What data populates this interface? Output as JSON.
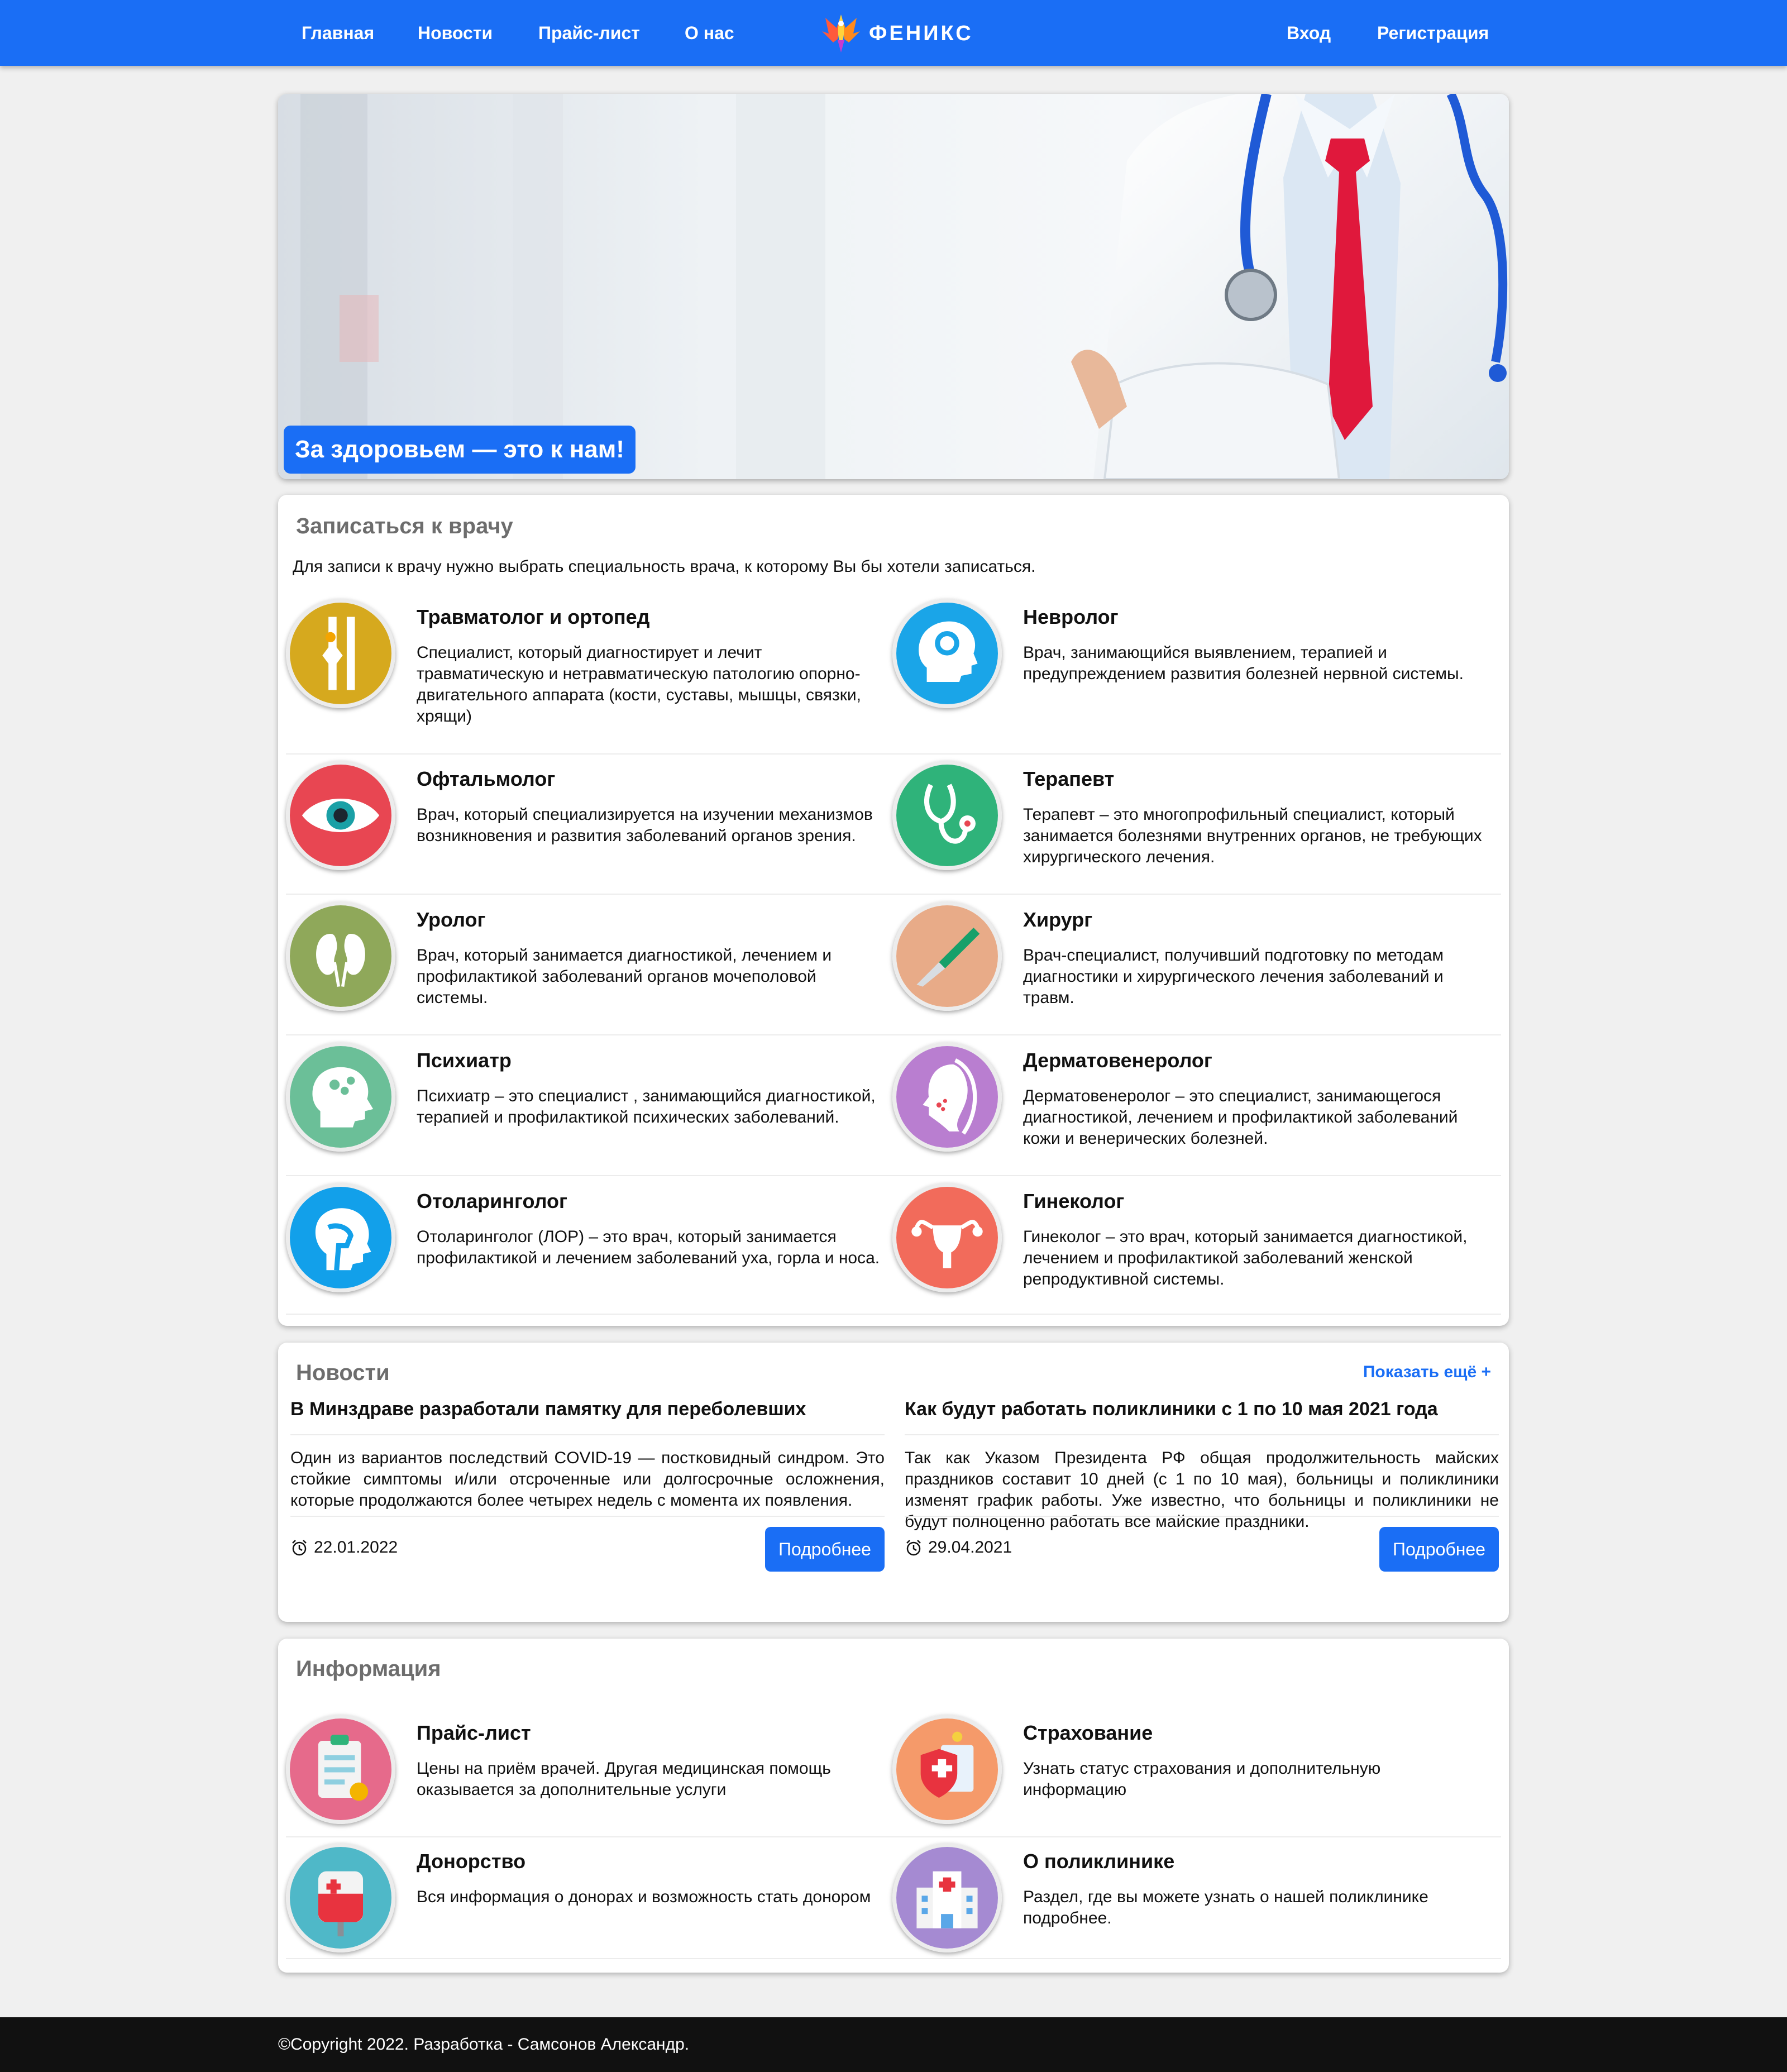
{
  "nav": {
    "links": [
      "Главная",
      "Новости",
      "Прайс-лист",
      "О нас"
    ],
    "brand": "ФЕНИКС",
    "login": "Вход",
    "register": "Регистрация"
  },
  "hero": {
    "slogan": "За здоровьем — это к нам!"
  },
  "doctors": {
    "title": "Записаться к врачу",
    "intro": "Для записи к врачу нужно выбрать специальность врача, к которому Вы бы хотели записаться.",
    "items": [
      {
        "title": "Травматолог и ортопед",
        "desc": "Специалист, который диагностирует и лечит травматическую и нетравматическую патологию опорно-двигательного аппарата (кости, суставы, мышцы, связки, хрящи)",
        "icon": "bone-joint-icon",
        "color": "#d6a91e"
      },
      {
        "title": "Невролог",
        "desc": "Врач, занимающийся выявлением, терапией и предупреждением развития болезней нервной системы.",
        "icon": "brain-head-icon",
        "color": "#1aa5e8"
      },
      {
        "title": "Офтальмолог",
        "desc": "Врач, который специализируется на изучении механизмов возникновения и развития заболеваний органов зрения.",
        "icon": "eye-icon",
        "color": "#e84652"
      },
      {
        "title": "Терапевт",
        "desc": "Терапевт – это многопрофильный специалист, который занимается болезнями внутренних органов, не требующих хирургического лечения.",
        "icon": "stethoscope-icon",
        "color": "#2fb37a"
      },
      {
        "title": "Уролог",
        "desc": "Врач, который занимается диагностикой, лечением и профилактикой заболеваний органов мочеполовой системы.",
        "icon": "kidneys-icon",
        "color": "#8fa85a"
      },
      {
        "title": "Хирург",
        "desc": "Врач-специалист, получивший подготовку по методам диагностики и хирургического лечения заболеваний и травм.",
        "icon": "scalpel-icon",
        "color": "#e8ab88"
      },
      {
        "title": "Психиатр",
        "desc": "Психиатр – это специалист , занимающийся диагностикой, терапией и профилактикой психических заболеваний.",
        "icon": "mind-head-icon",
        "color": "#6bbf98"
      },
      {
        "title": "Дерматовенеролог",
        "desc": "Дерматовенеролог – это специалист, занимающегося диагностикой, лечением и профилактикой заболеваний кожи и венерических болезней.",
        "icon": "face-skin-icon",
        "color": "#b97ed0"
      },
      {
        "title": "Отоларинголог",
        "desc": "Отоларинголог (ЛОР) – это врач, который занимается профилактикой и лечением заболеваний уха, горла и носа.",
        "icon": "ent-head-icon",
        "color": "#12a0ea"
      },
      {
        "title": "Гинеколог",
        "desc": "Гинеколог – это врач, который занимается диагностикой, лечением и профилактикой заболеваний женской репродуктивной системы.",
        "icon": "uterus-icon",
        "color": "#f26b5b"
      }
    ]
  },
  "news": {
    "title": "Новости",
    "show_more": "Показать ещё +",
    "items": [
      {
        "title": "В Минздраве разработали памятку для переболевших",
        "text": "Один из вариантов последствий COVID-19 — постковидный синдром. Это стойкие симптомы и/или отсроченные или долгосрочные осложнения, которые продолжаются более четырех недель с момента их появления.",
        "date": "22.01.2022",
        "button": "Подробнее"
      },
      {
        "title": "Как будут работать поликлиники с 1 по 10 мая 2021 года",
        "text": "Так как Указом Президента РФ общая продолжительность майских праздников составит 10 дней (с 1 по 10 мая), больницы и поликлиники изменят график работы. Уже известно, что больницы и поликлиники не будут полноценно работать все майские праздники.",
        "date": "29.04.2021",
        "button": "Подробнее"
      }
    ]
  },
  "info": {
    "title": "Информация",
    "items": [
      {
        "title": "Прайс-лист",
        "desc": "Цены на приём врачей. Другая медицинская помощь оказывается за дополнительные услуги",
        "icon": "price-list-icon",
        "color": "#e66a8b"
      },
      {
        "title": "Страхование",
        "desc": "Узнать статус страхования и дополнительную информацию",
        "icon": "insurance-shield-icon",
        "color": "#f59a6a"
      },
      {
        "title": "Донорство",
        "desc": "Вся информация о донорах и возможность стать донором",
        "icon": "blood-bag-icon",
        "color": "#4fb8c8"
      },
      {
        "title": "О поликлинике",
        "desc": "Раздел, где вы можете узнать о нашей поликлинике подробнее.",
        "icon": "hospital-building-icon",
        "color": "#a58ad2"
      }
    ]
  },
  "footer": {
    "copyright": "©Copyright 2022. Разработка - Самсонов Александр."
  },
  "colors": {
    "accent": "#1a6ef5",
    "footer_bg": "#111111",
    "page_bg": "#f0f0f0"
  }
}
